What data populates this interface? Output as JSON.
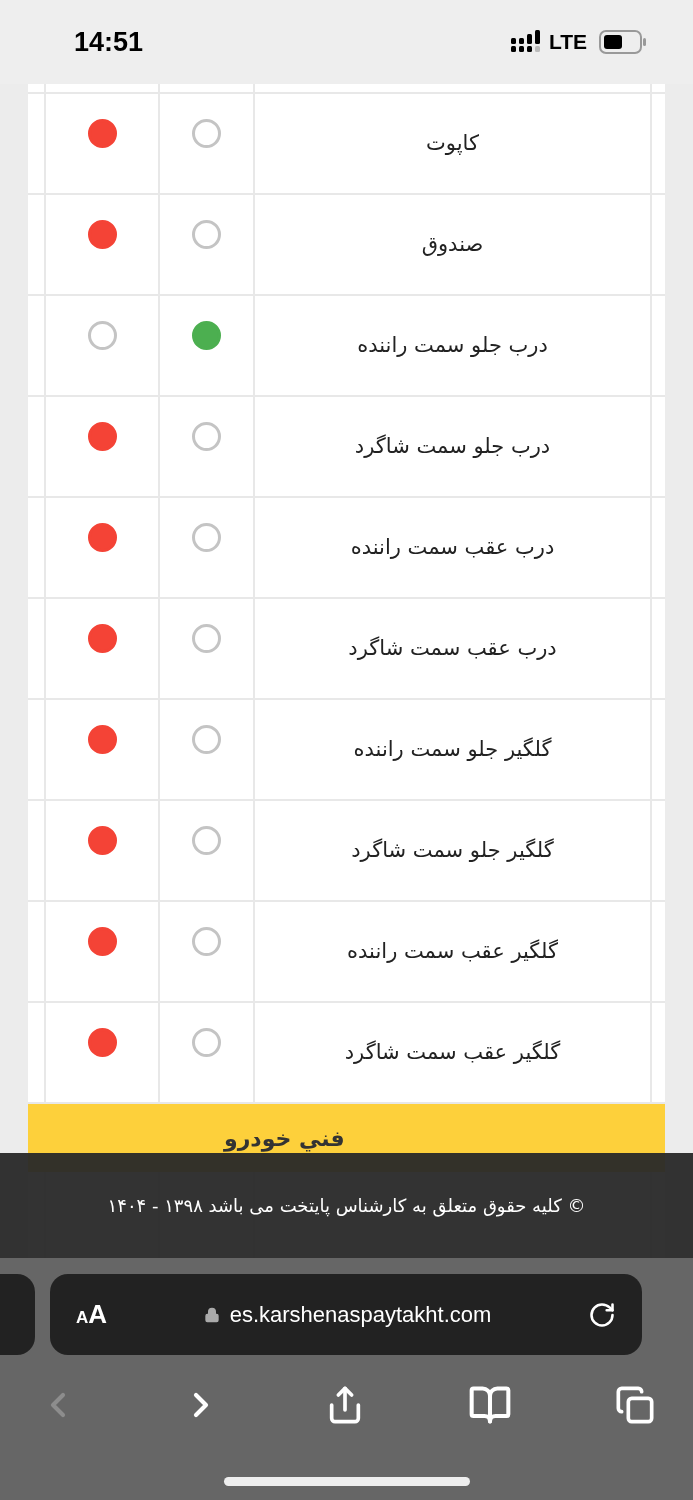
{
  "status_bar": {
    "time": "14:51",
    "network": "LTE"
  },
  "rows": [
    {
      "label": "کاپوت",
      "ok": {
        "selected": false
      },
      "damaged": {
        "selected": true
      }
    },
    {
      "label": "صندوق",
      "ok": {
        "selected": false
      },
      "damaged": {
        "selected": true
      }
    },
    {
      "label": "درب جلو سمت راننده",
      "ok": {
        "selected": true
      },
      "damaged": {
        "selected": false
      }
    },
    {
      "label": "درب جلو سمت شاگرد",
      "ok": {
        "selected": false
      },
      "damaged": {
        "selected": true
      }
    },
    {
      "label": "درب عقب سمت راننده",
      "ok": {
        "selected": false
      },
      "damaged": {
        "selected": true
      }
    },
    {
      "label": "درب عقب سمت شاگرد",
      "ok": {
        "selected": false
      },
      "damaged": {
        "selected": true
      }
    },
    {
      "label": "گلگیر جلو سمت راننده",
      "ok": {
        "selected": false
      },
      "damaged": {
        "selected": true
      }
    },
    {
      "label": "گلگیر جلو سمت شاگرد",
      "ok": {
        "selected": false
      },
      "damaged": {
        "selected": true
      }
    },
    {
      "label": "گلگیر عقب سمت راننده",
      "ok": {
        "selected": false
      },
      "damaged": {
        "selected": true
      }
    },
    {
      "label": "گلگیر عقب سمت شاگرد",
      "ok": {
        "selected": false
      },
      "damaged": {
        "selected": true
      }
    }
  ],
  "section": {
    "title": "فني خودرو"
  },
  "footer": {
    "copyright": "© کلیه حقوق متعلق به کارشناس پایتخت می باشد ۱۳۹۸ - ۱۴۰۴"
  },
  "browser": {
    "text_size": "AA",
    "url": "es.karshenaspaytakht.com",
    "back_disabled": true
  }
}
